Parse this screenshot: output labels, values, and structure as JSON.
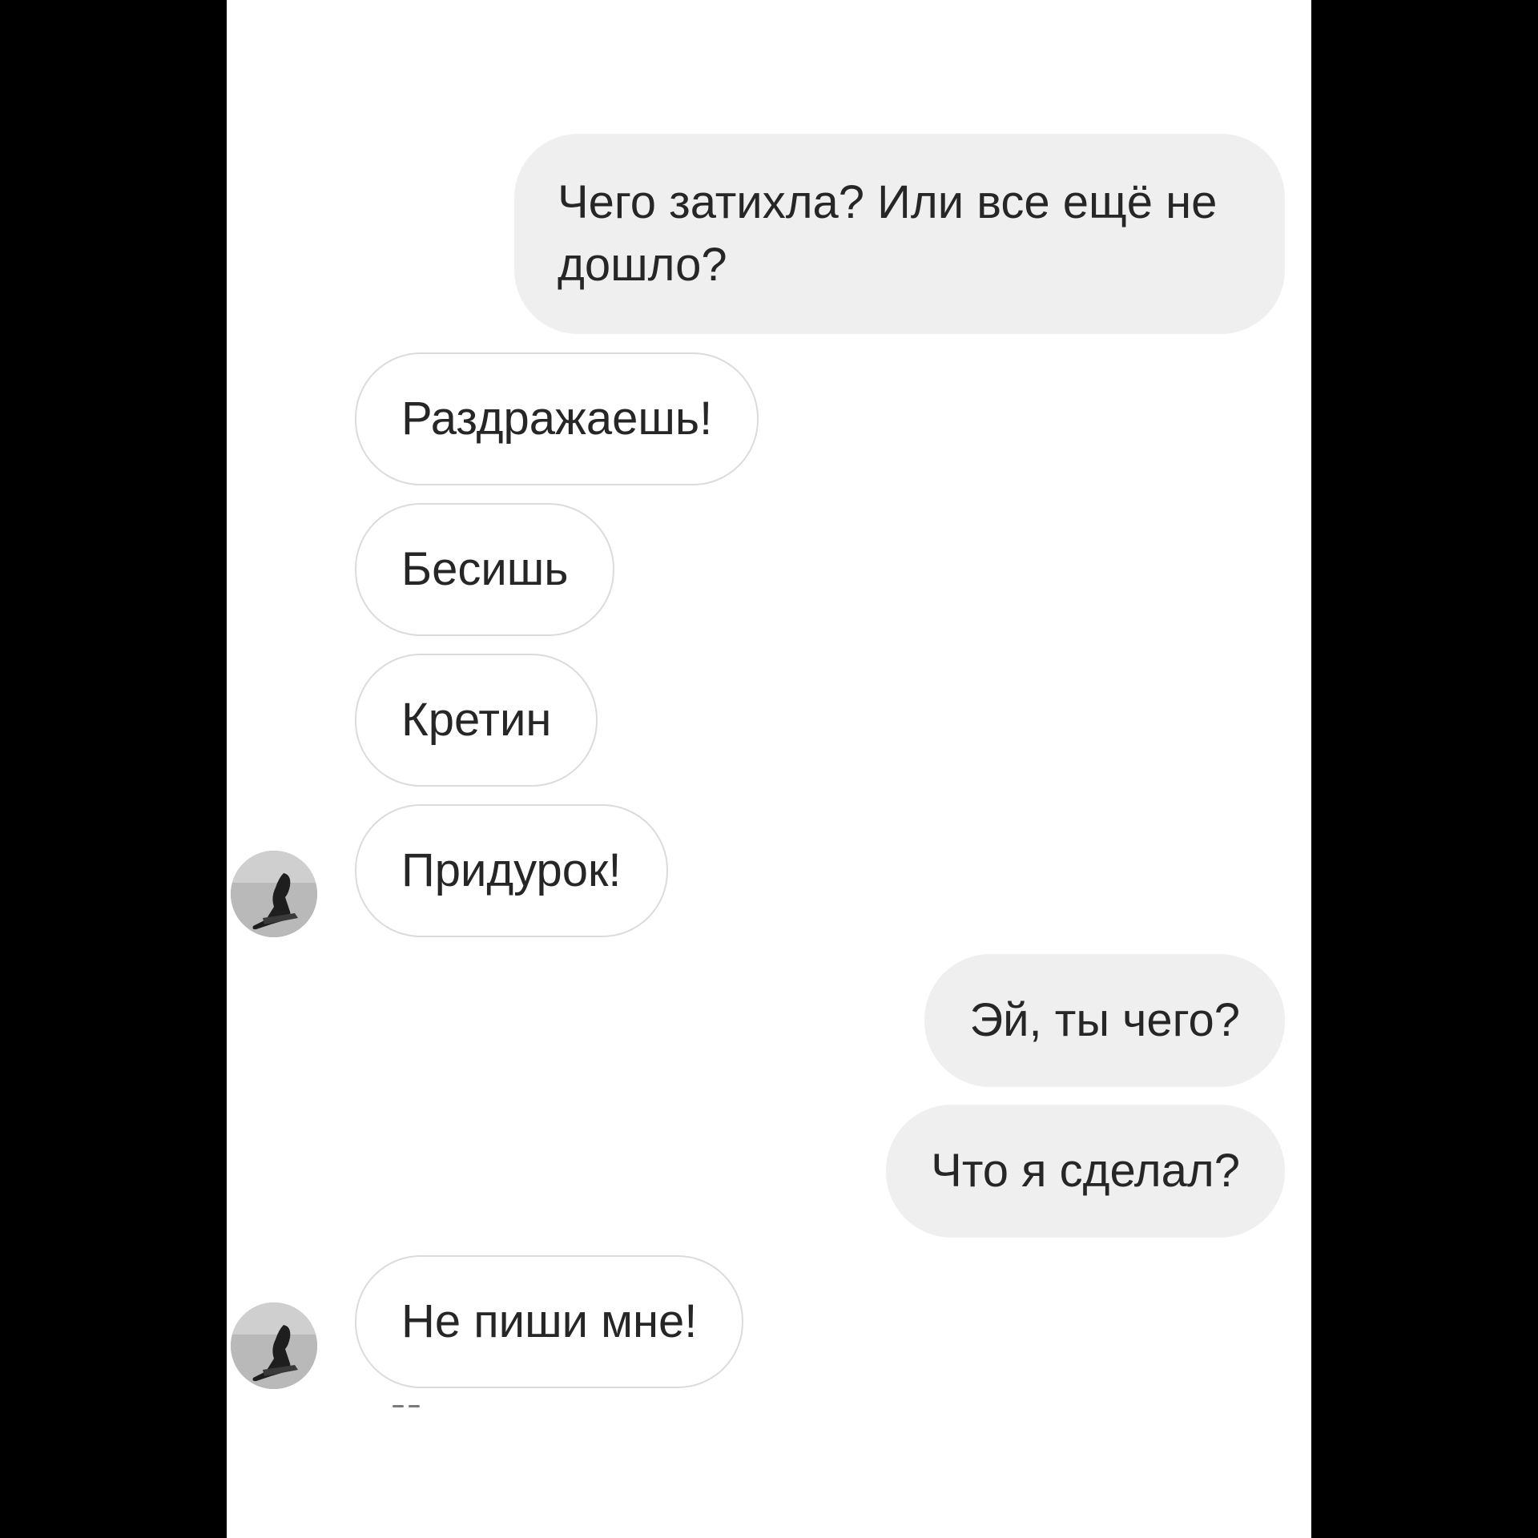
{
  "messages": [
    {
      "direction": "outgoing",
      "text": "Чего затихла? Или все ещё не дошло?"
    },
    {
      "direction": "incoming",
      "text": "Раздражаешь!"
    },
    {
      "direction": "incoming",
      "text": "Бесишь"
    },
    {
      "direction": "incoming",
      "text": "Кретин"
    },
    {
      "direction": "incoming",
      "text": "Придурок!"
    },
    {
      "direction": "outgoing",
      "text": "Эй, ты чего?"
    },
    {
      "direction": "outgoing",
      "text": "Что я сделал?"
    },
    {
      "direction": "incoming",
      "text": "Не пиши мне!"
    }
  ],
  "colors": {
    "outgoing_bubble": "#efefef",
    "incoming_bubble": "#ffffff",
    "incoming_border": "#dbdbdb",
    "text": "#262626",
    "letterbox": "#000000"
  },
  "icons": {
    "avatar": "contact-avatar-photo"
  }
}
